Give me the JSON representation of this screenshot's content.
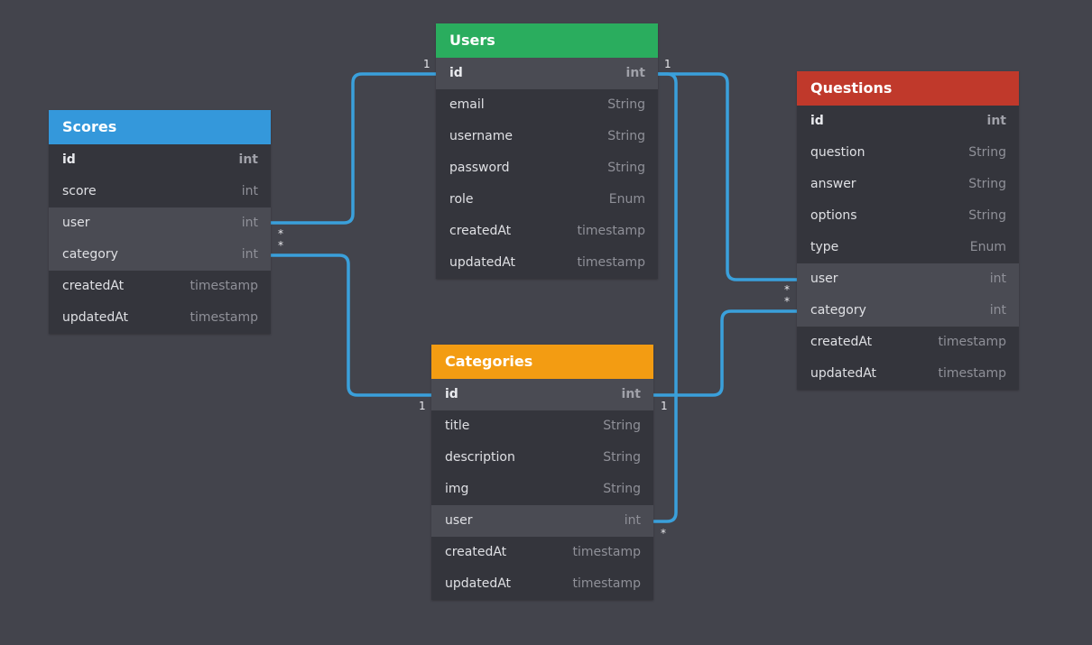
{
  "tables": {
    "users": {
      "title": "Users",
      "color": "#2aad5e",
      "fields": [
        {
          "name": "id",
          "type": "int"
        },
        {
          "name": "email",
          "type": "String"
        },
        {
          "name": "username",
          "type": "String"
        },
        {
          "name": "password",
          "type": "String"
        },
        {
          "name": "role",
          "type": "Enum"
        },
        {
          "name": "createdAt",
          "type": "timestamp"
        },
        {
          "name": "updatedAt",
          "type": "timestamp"
        }
      ]
    },
    "scores": {
      "title": "Scores",
      "color": "#3498db",
      "fields": [
        {
          "name": "id",
          "type": "int"
        },
        {
          "name": "score",
          "type": "int"
        },
        {
          "name": "user",
          "type": "int"
        },
        {
          "name": "category",
          "type": "int"
        },
        {
          "name": "createdAt",
          "type": "timestamp"
        },
        {
          "name": "updatedAt",
          "type": "timestamp"
        }
      ]
    },
    "questions": {
      "title": "Questions",
      "color": "#c0392b",
      "fields": [
        {
          "name": "id",
          "type": "int"
        },
        {
          "name": "question",
          "type": "String"
        },
        {
          "name": "answer",
          "type": "String"
        },
        {
          "name": "options",
          "type": "String"
        },
        {
          "name": "type",
          "type": "Enum"
        },
        {
          "name": "user",
          "type": "int"
        },
        {
          "name": "category",
          "type": "int"
        },
        {
          "name": "createdAt",
          "type": "timestamp"
        },
        {
          "name": "updatedAt",
          "type": "timestamp"
        }
      ]
    },
    "categories": {
      "title": "Categories",
      "color": "#f39c12",
      "fields": [
        {
          "name": "id",
          "type": "int"
        },
        {
          "name": "title",
          "type": "String"
        },
        {
          "name": "description",
          "type": "String"
        },
        {
          "name": "img",
          "type": "String"
        },
        {
          "name": "user",
          "type": "int"
        },
        {
          "name": "createdAt",
          "type": "timestamp"
        },
        {
          "name": "updatedAt",
          "type": "timestamp"
        }
      ]
    }
  },
  "relation_color": "#3aa0db",
  "cardinality": {
    "one": "1",
    "many": "*"
  },
  "relations": [
    {
      "from": "scores.user",
      "to": "users.id",
      "from_card": "*",
      "to_card": "1"
    },
    {
      "from": "scores.category",
      "to": "categories.id",
      "from_card": "*",
      "to_card": "1"
    },
    {
      "from": "questions.user",
      "to": "users.id",
      "from_card": "*",
      "to_card": "1"
    },
    {
      "from": "questions.category",
      "to": "categories.id",
      "from_card": "*",
      "to_card": "1"
    },
    {
      "from": "categories.user",
      "to": "users.id",
      "from_card": "*",
      "to_card": "1"
    }
  ]
}
